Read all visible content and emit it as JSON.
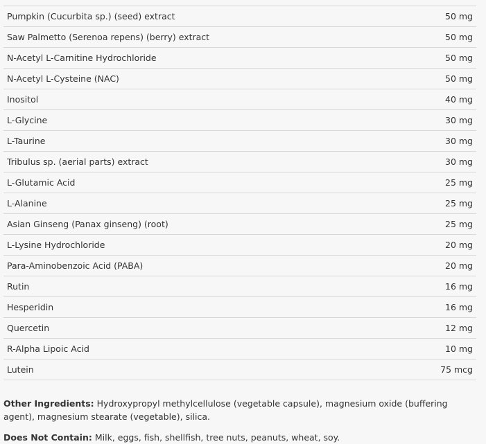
{
  "ingredients": [
    {
      "name": "Pumpkin (Cucurbita sp.) (seed) extract",
      "amount": "50 mg"
    },
    {
      "name": "Saw Palmetto (Serenoa repens) (berry) extract",
      "amount": "50 mg"
    },
    {
      "name": "N-Acetyl L-Carnitine Hydrochloride",
      "amount": "50 mg"
    },
    {
      "name": "N-Acetyl L-Cysteine (NAC)",
      "amount": "50 mg"
    },
    {
      "name": "Inositol",
      "amount": "40 mg"
    },
    {
      "name": "L-Glycine",
      "amount": "30 mg"
    },
    {
      "name": "L-Taurine",
      "amount": "30 mg"
    },
    {
      "name": "Tribulus sp. (aerial parts) extract",
      "amount": "30 mg"
    },
    {
      "name": "L-Glutamic Acid",
      "amount": "25 mg"
    },
    {
      "name": "L-Alanine",
      "amount": "25 mg"
    },
    {
      "name": "Asian Ginseng (Panax ginseng) (root)",
      "amount": "25 mg"
    },
    {
      "name": "L-Lysine Hydrochloride",
      "amount": "20 mg"
    },
    {
      "name": "Para-Aminobenzoic Acid (PABA)",
      "amount": "20 mg"
    },
    {
      "name": "Rutin",
      "amount": "16 mg"
    },
    {
      "name": "Hesperidin",
      "amount": "16 mg"
    },
    {
      "name": "Quercetin",
      "amount": "12 mg"
    },
    {
      "name": "R-Alpha Lipoic Acid",
      "amount": "10 mg"
    },
    {
      "name": "Lutein",
      "amount": "75 mcg"
    }
  ],
  "other_ingredients": {
    "label": "Other Ingredients:",
    "text": " Hydroxypropyl methylcellulose (vegetable capsule), magnesium oxide (buffering agent), magnesium stearate (vegetable), silica."
  },
  "does_not_contain": {
    "label": "Does Not Contain:",
    "text": " Milk, eggs, fish, shellfish, tree nuts, peanuts, wheat, soy."
  }
}
